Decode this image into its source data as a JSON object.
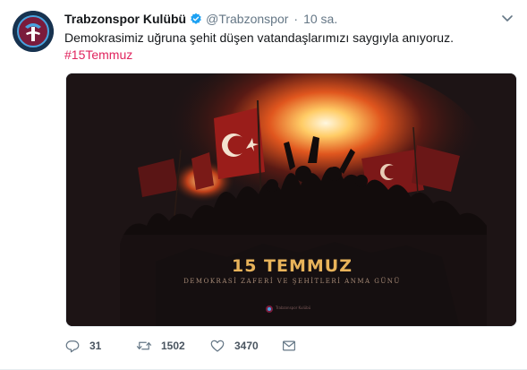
{
  "tweet": {
    "name": "Trabzonspor Kulübü",
    "handle": "@Trabzonspor",
    "separator": "·",
    "time": "10 sa.",
    "text": "Demokrasimiz uğruna şehit düşen vatandaşlarımızı saygıyla anıyoruz.",
    "hashtag": "#15Temmuz",
    "verified": true
  },
  "media": {
    "title": "15 TEMMUZ",
    "subtitle": "DEMOKRASİ ZAFERİ VE ŞEHİTLERİ ANMA GÜNÜ",
    "logo_text": "Trabzonspor Kulübü"
  },
  "actions": {
    "reply_count": "31",
    "retweet_count": "1502",
    "like_count": "3470"
  },
  "colors": {
    "hashtag": "#e0245e",
    "verified": "#1da1f2",
    "club_primary": "#7b1c3c",
    "club_secondary": "#4aa3df",
    "title_gold": "#e8b35a"
  },
  "icons": [
    "club-logo-icon",
    "verified-badge-icon",
    "chevron-down-icon",
    "reply-icon",
    "retweet-icon",
    "like-icon",
    "message-icon"
  ]
}
